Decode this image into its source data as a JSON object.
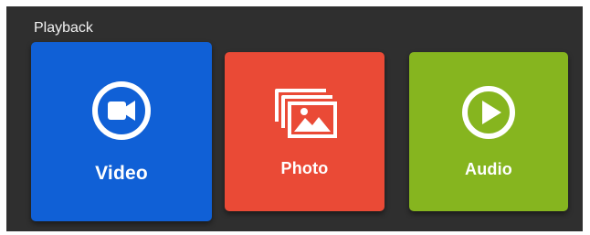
{
  "section": {
    "title": "Playback"
  },
  "tiles": [
    {
      "label": "Video",
      "icon": "video-camera-icon",
      "color": "#1060d6"
    },
    {
      "label": "Photo",
      "icon": "photo-gallery-icon",
      "color": "#ea4a36"
    },
    {
      "label": "Audio",
      "icon": "play-circle-icon",
      "color": "#86b51f"
    }
  ],
  "colors": {
    "panel_background": "#2f2f2f",
    "title_text": "#f2f2f2",
    "tile_text": "#ffffff"
  }
}
